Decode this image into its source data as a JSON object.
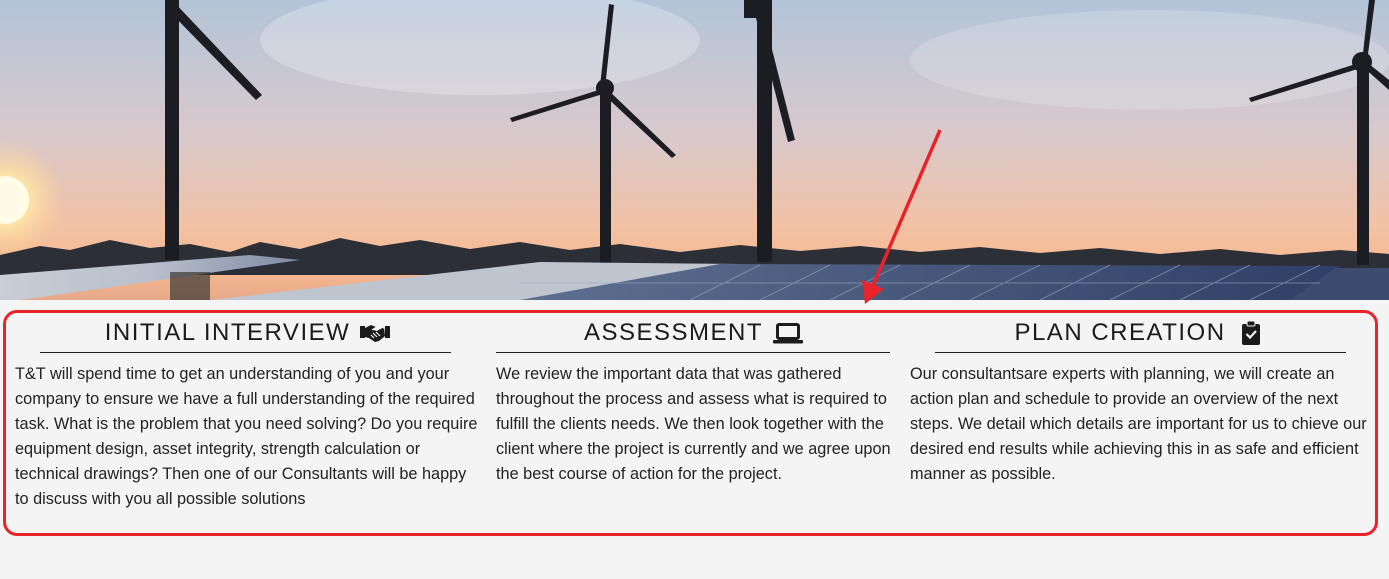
{
  "hero": {
    "icon": "wind-turbines-solar-panels-photo"
  },
  "columns": [
    {
      "title": "INITIAL INTERVIEW",
      "icon": "handshake-icon",
      "text": "T&T will spend time to get an understanding of you and your company to ensure we have a full understanding of the required task. What is the problem that you need solving? Do you require equipment design, asset integrity, strength calculation or technical drawings? Then one of our Consultants will be happy to discuss with you all possible solutions"
    },
    {
      "title": "ASSESSMENT",
      "icon": "laptop-icon",
      "text": "We review the important data that was gathered throughout the process and assess what is required to fulfill the clients needs. We then look together with the client where the project is currently and we agree upon the best course of action for the project."
    },
    {
      "title": "PLAN CREATION",
      "icon": "clipboard-check-icon",
      "text": "Our consultantsare experts with planning, we will create an action plan and schedule to provide an overview of the next steps. We detail which details are important for us to chieve our desired end results while achieving this in as safe and efficient manner as possible."
    }
  ],
  "annotation": {
    "color": "#e8232a"
  }
}
